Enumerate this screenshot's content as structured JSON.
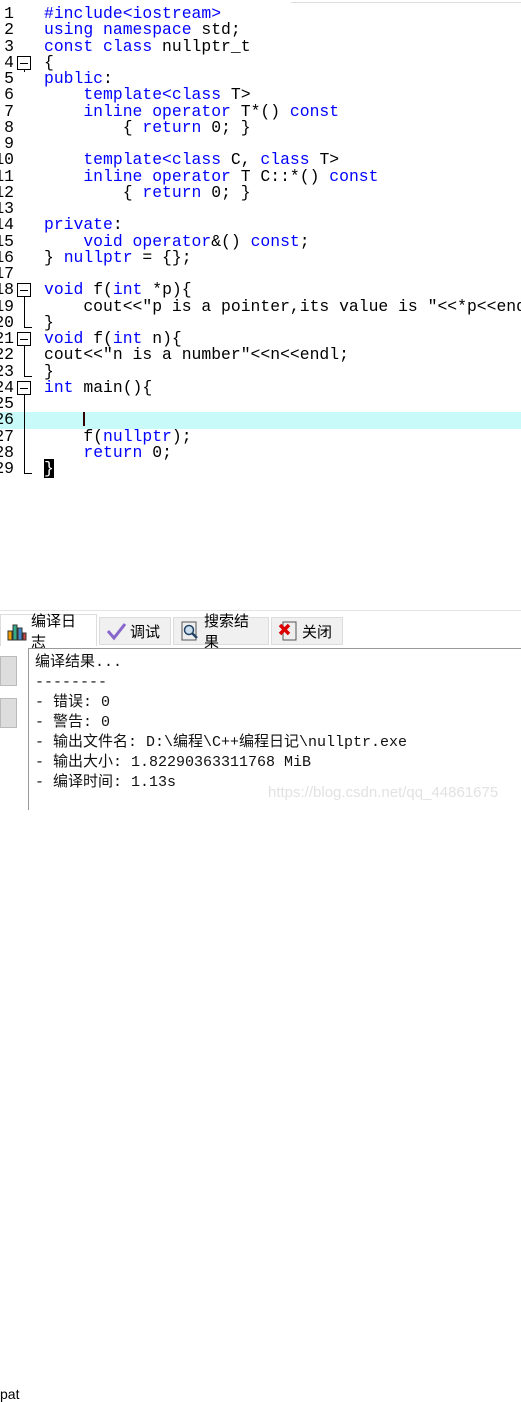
{
  "editor": {
    "current_line": 26,
    "lines": [
      {
        "n": "1",
        "t": [
          [
            "#include<iostream>",
            "k"
          ]
        ]
      },
      {
        "n": "2",
        "t": [
          [
            "using namespace",
            "k"
          ],
          [
            " std;",
            "s"
          ]
        ]
      },
      {
        "n": "3",
        "t": [
          [
            "const class",
            "k"
          ],
          [
            " nullptr_t",
            "s"
          ]
        ]
      },
      {
        "n": "4",
        "fold": "open",
        "t": [
          [
            "{",
            "s"
          ]
        ]
      },
      {
        "n": "5",
        "t": [
          [
            "public",
            "k"
          ],
          [
            ":",
            "s"
          ]
        ]
      },
      {
        "n": "6",
        "t": [
          [
            "    template<class",
            "k"
          ],
          [
            " T>",
            "s"
          ]
        ]
      },
      {
        "n": "7",
        "t": [
          [
            "    inline operator",
            "k"
          ],
          [
            " T*() ",
            "s"
          ],
          [
            "const",
            "k"
          ]
        ]
      },
      {
        "n": "8",
        "t": [
          [
            "        { ",
            "s"
          ],
          [
            "return",
            "k"
          ],
          [
            " 0; }",
            "s"
          ]
        ]
      },
      {
        "n": "9",
        "t": []
      },
      {
        "n": "10",
        "t": [
          [
            "    template<class",
            "k"
          ],
          [
            " C, ",
            "s"
          ],
          [
            "class",
            "k"
          ],
          [
            " T>",
            "s"
          ]
        ]
      },
      {
        "n": "11",
        "t": [
          [
            "    inline operator",
            "k"
          ],
          [
            " T C::*() ",
            "s"
          ],
          [
            "const",
            "k"
          ]
        ]
      },
      {
        "n": "12",
        "t": [
          [
            "        { ",
            "s"
          ],
          [
            "return",
            "k"
          ],
          [
            " 0; }",
            "s"
          ]
        ]
      },
      {
        "n": "13",
        "t": []
      },
      {
        "n": "14",
        "t": [
          [
            "private",
            "k"
          ],
          [
            ":",
            "s"
          ]
        ]
      },
      {
        "n": "15",
        "t": [
          [
            "    void operator",
            "k"
          ],
          [
            "&() ",
            "s"
          ],
          [
            "const",
            "k"
          ],
          [
            ";",
            "s"
          ]
        ]
      },
      {
        "n": "16",
        "t": [
          [
            "} ",
            "s"
          ],
          [
            "nullptr",
            "k"
          ],
          [
            " = {};",
            "s"
          ]
        ]
      },
      {
        "n": "17",
        "t": []
      },
      {
        "n": "18",
        "fold": "open",
        "t": [
          [
            "void",
            "k"
          ],
          [
            " f(",
            "s"
          ],
          [
            "int",
            "k"
          ],
          [
            " *p){",
            "s"
          ]
        ]
      },
      {
        "n": "19",
        "fold": "mid",
        "t": [
          [
            "    cout<<\"p is a pointer,its value is \"<<*p<<endl;",
            "s"
          ]
        ]
      },
      {
        "n": "20",
        "fold": "end",
        "t": [
          [
            "}",
            "s"
          ]
        ]
      },
      {
        "n": "21",
        "fold": "open",
        "t": [
          [
            "void",
            "k"
          ],
          [
            " f(",
            "s"
          ],
          [
            "int",
            "k"
          ],
          [
            " n){",
            "s"
          ]
        ]
      },
      {
        "n": "22",
        "fold": "mid",
        "t": [
          [
            "cout<<\"n is a number\"<<n<<endl;",
            "s"
          ]
        ]
      },
      {
        "n": "23",
        "fold": "end",
        "t": [
          [
            "}",
            "s"
          ]
        ]
      },
      {
        "n": "24",
        "fold": "open",
        "t": [
          [
            "int",
            "k"
          ],
          [
            " main(){",
            "s"
          ]
        ]
      },
      {
        "n": "25",
        "fold": "mid",
        "t": []
      },
      {
        "n": "26",
        "fold": "mid",
        "caret": true,
        "t": [
          [
            "    ",
            "s"
          ]
        ]
      },
      {
        "n": "27",
        "fold": "mid",
        "t": [
          [
            "    f(",
            "s"
          ],
          [
            "nullptr",
            "k"
          ],
          [
            ");",
            "s"
          ]
        ]
      },
      {
        "n": "28",
        "fold": "mid",
        "t": [
          [
            "    ",
            "s"
          ],
          [
            "return",
            "k"
          ],
          [
            " 0;",
            "s"
          ]
        ]
      },
      {
        "n": "29",
        "fold": "end",
        "t": [
          [
            "}",
            "sel"
          ]
        ]
      }
    ]
  },
  "tabs": [
    {
      "label": "编译日志",
      "icon": "bar-chart-icon",
      "active": true
    },
    {
      "label": "调试",
      "icon": "checkmark-icon"
    },
    {
      "label": "搜索结果",
      "icon": "magnifier-icon"
    },
    {
      "label": "关闭",
      "icon": "close-icon"
    }
  ],
  "left_panel": {
    "partial_label": "pat"
  },
  "output": {
    "lines": [
      "编译结果...",
      "--------",
      "- 错误: 0",
      "- 警告: 0",
      "- 输出文件名: D:\\编程\\C++编程日记\\nullptr.exe",
      "- 输出大小: 1.82290363311768 MiB",
      "- 编译时间: 1.13s"
    ]
  },
  "watermark": "https://blog.csdn.net/qq_44861675",
  "colors": {
    "keyword": "#0000ff",
    "current_line": "#c8fafa"
  }
}
